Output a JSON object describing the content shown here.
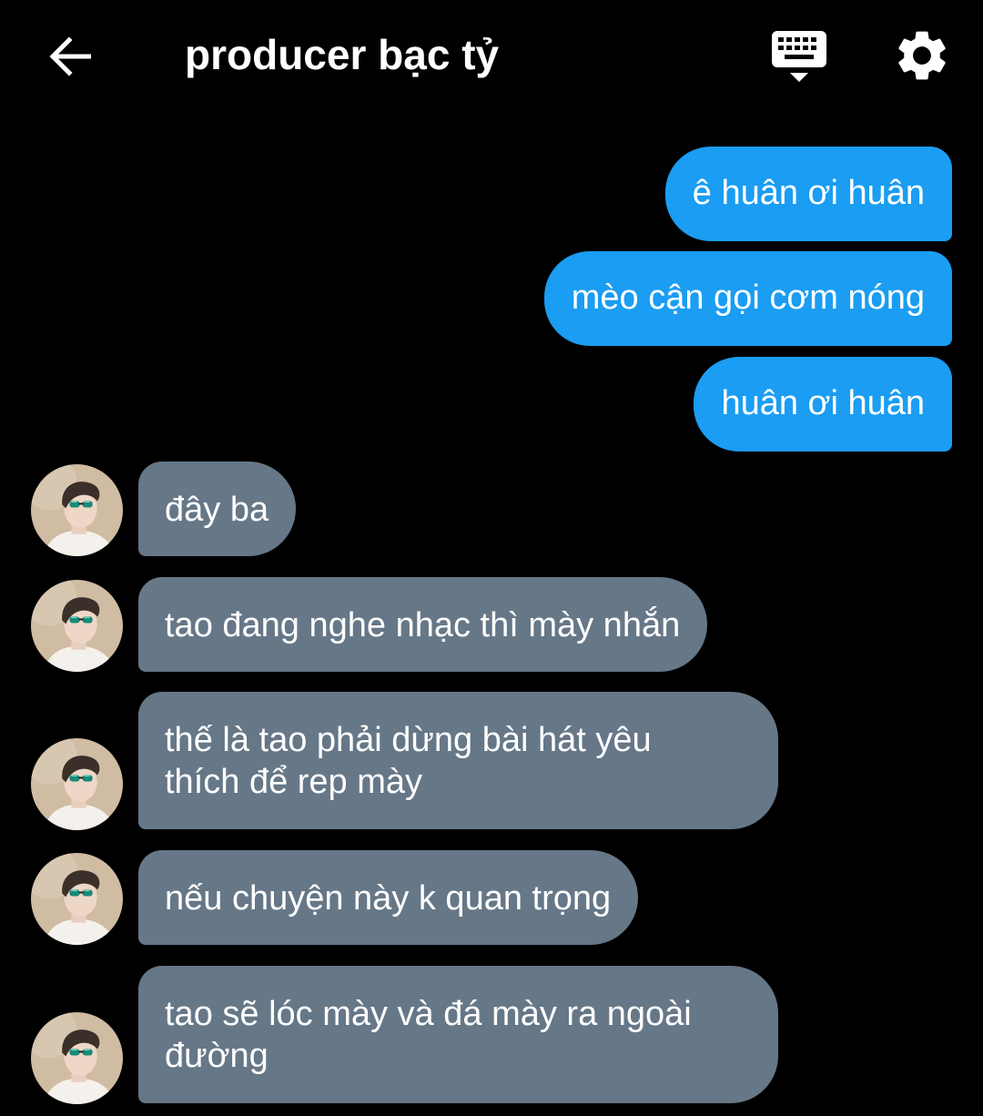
{
  "header": {
    "title": "producer bạc tỷ",
    "back_icon": "arrow-left-icon",
    "keyboard_icon": "keyboard-icon",
    "settings_icon": "gear-icon"
  },
  "colors": {
    "background": "#000000",
    "sent_bubble": "#1a9df2",
    "received_bubble": "#667787",
    "text": "#ffffff"
  },
  "messages": [
    {
      "from": "me",
      "lines": [
        "ê huân ơi huân"
      ]
    },
    {
      "from": "me",
      "lines": [
        "mèo cận gọi cơm nóng"
      ]
    },
    {
      "from": "me",
      "lines": [
        "huân ơi huân"
      ]
    },
    {
      "from": "contact",
      "lines": [
        "đây ba"
      ]
    },
    {
      "from": "contact",
      "lines": [
        "tao đang nghe nhạc thì mày nhắn"
      ]
    },
    {
      "from": "contact",
      "lines": [
        "thế là tao phải dừng bài hát yêu",
        "thích để rep mày"
      ]
    },
    {
      "from": "contact",
      "lines": [
        "nếu chuyện này k quan trọng"
      ]
    },
    {
      "from": "contact",
      "lines": [
        "tao sẽ lóc mày và đá mày ra ngoài",
        "đường"
      ]
    }
  ]
}
